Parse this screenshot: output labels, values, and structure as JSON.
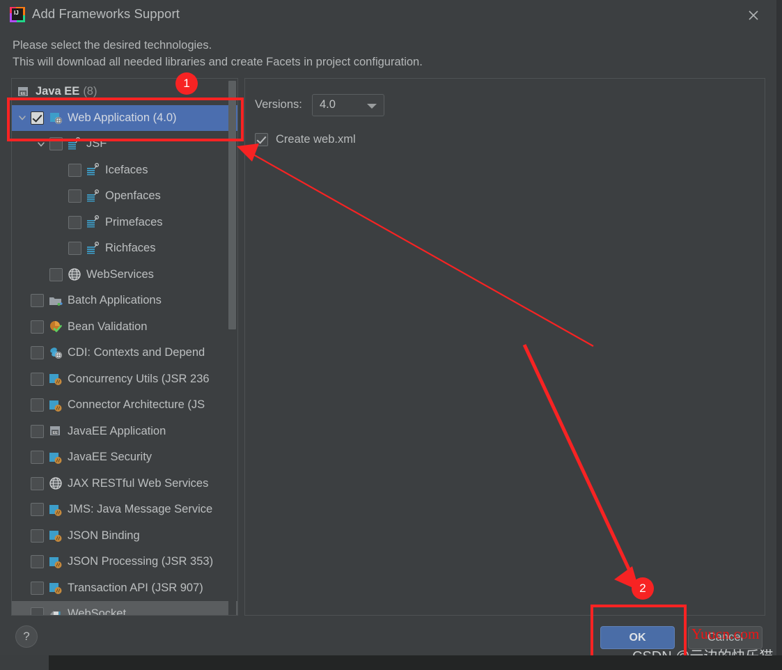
{
  "window": {
    "title": "Add Frameworks Support",
    "app_icon": "intellij-idea-icon",
    "close_icon": "close-icon"
  },
  "description": {
    "line1": "Please select the desired technologies.",
    "line2": "This will download all needed libraries and create Facets in project configuration."
  },
  "tree": {
    "group": {
      "label": "Java EE",
      "count": "(8)",
      "icon": "javaee-module-icon"
    },
    "items": [
      {
        "label": "Web Application (4.0)",
        "icon": "web-application-icon",
        "checked": true,
        "selected": true,
        "expanded": true,
        "indent": 0,
        "has_arrow": true
      },
      {
        "label": "JSF",
        "icon": "jsf-icon",
        "checked": false,
        "selected": false,
        "expanded": true,
        "indent": 1,
        "has_arrow": true
      },
      {
        "label": "Icefaces",
        "icon": "jsf-icon",
        "checked": false,
        "selected": false,
        "indent": 2,
        "has_arrow": false
      },
      {
        "label": "Openfaces",
        "icon": "jsf-icon",
        "checked": false,
        "selected": false,
        "indent": 2,
        "has_arrow": false
      },
      {
        "label": "Primefaces",
        "icon": "jsf-icon",
        "checked": false,
        "selected": false,
        "indent": 2,
        "has_arrow": false
      },
      {
        "label": "Richfaces",
        "icon": "jsf-icon",
        "checked": false,
        "selected": false,
        "indent": 2,
        "has_arrow": false
      },
      {
        "label": "WebServices",
        "icon": "globe-icon",
        "checked": false,
        "selected": false,
        "indent": 1,
        "has_arrow": false
      },
      {
        "label": "Batch Applications",
        "icon": "batch-folder-icon",
        "checked": false,
        "selected": false,
        "indent": 0,
        "has_arrow": false
      },
      {
        "label": "Bean Validation",
        "icon": "bean-validation-icon",
        "checked": false,
        "selected": false,
        "indent": 0,
        "has_arrow": false
      },
      {
        "label": "CDI: Contexts and Depend",
        "icon": "cdi-icon",
        "checked": false,
        "selected": false,
        "indent": 0,
        "has_arrow": false
      },
      {
        "label": "Concurrency Utils (JSR 236",
        "icon": "java-bean-icon",
        "checked": false,
        "selected": false,
        "indent": 0,
        "has_arrow": false
      },
      {
        "label": "Connector Architecture (JS",
        "icon": "java-bean-icon",
        "checked": false,
        "selected": false,
        "indent": 0,
        "has_arrow": false
      },
      {
        "label": "JavaEE Application",
        "icon": "javaee-module-icon",
        "checked": false,
        "selected": false,
        "indent": 0,
        "has_arrow": false
      },
      {
        "label": "JavaEE Security",
        "icon": "java-bean-icon",
        "checked": false,
        "selected": false,
        "indent": 0,
        "has_arrow": false
      },
      {
        "label": "JAX RESTful Web Services",
        "icon": "globe-icon",
        "checked": false,
        "selected": false,
        "indent": 0,
        "has_arrow": false
      },
      {
        "label": "JMS: Java Message Service",
        "icon": "java-bean-icon",
        "checked": false,
        "selected": false,
        "indent": 0,
        "has_arrow": false
      },
      {
        "label": "JSON Binding",
        "icon": "java-bean-icon",
        "checked": false,
        "selected": false,
        "indent": 0,
        "has_arrow": false
      },
      {
        "label": "JSON Processing (JSR 353)",
        "icon": "java-bean-icon",
        "checked": false,
        "selected": false,
        "indent": 0,
        "has_arrow": false
      },
      {
        "label": "Transaction API (JSR 907)",
        "icon": "java-bean-icon",
        "checked": false,
        "selected": false,
        "indent": 0,
        "has_arrow": false
      },
      {
        "label": "WebSocket",
        "icon": "websocket-icon",
        "checked": false,
        "selected": false,
        "hovered": true,
        "indent": 0,
        "has_arrow": false
      }
    ]
  },
  "details": {
    "versions_label": "Versions:",
    "versions_value": "4.0",
    "versions_arrow_icon": "chevron-down-icon",
    "create_webxml_label": "Create web.xml",
    "create_webxml_checked": true
  },
  "footer": {
    "help_label": "?",
    "ok_label": "OK",
    "cancel_label": "Cancel"
  },
  "annotations": {
    "badge_1": "1",
    "badge_2": "2",
    "accent_color": "#f72323"
  },
  "watermarks": {
    "site": "Yuucn.com",
    "author": "CSDN @云边的快乐猫"
  }
}
